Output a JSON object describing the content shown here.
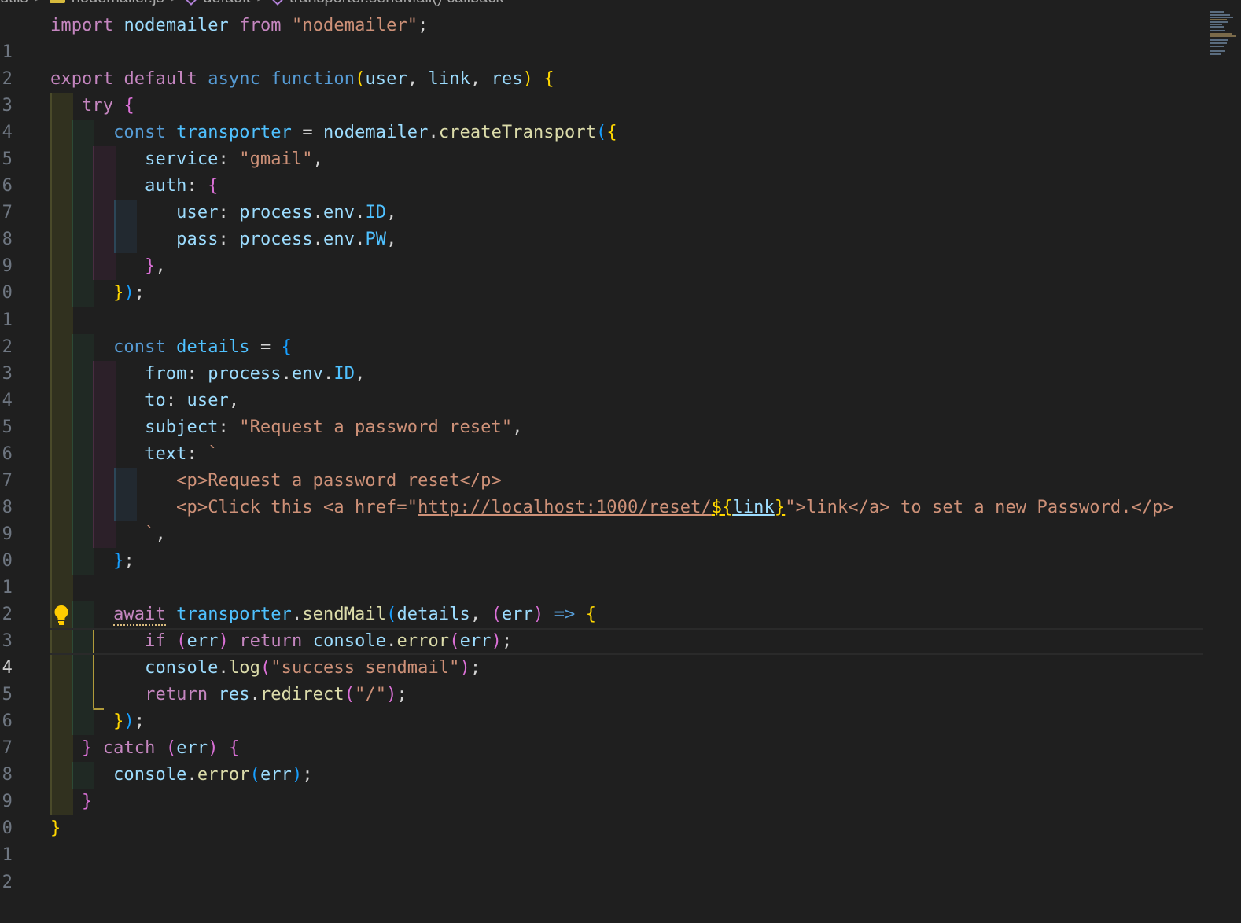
{
  "breadcrumb": {
    "items": [
      "utils",
      "nodemailer.js",
      "default",
      "transporter.sendMail() callback"
    ],
    "separator": ">",
    "js_badge": "JS"
  },
  "editor": {
    "active_line": 24,
    "lines": [
      {
        "n": "1"
      },
      {
        "n": "2"
      },
      {
        "n": "3"
      },
      {
        "n": "4"
      },
      {
        "n": "5"
      },
      {
        "n": "6"
      },
      {
        "n": "7"
      },
      {
        "n": "8"
      },
      {
        "n": "9"
      },
      {
        "n": "0"
      },
      {
        "n": "1"
      },
      {
        "n": "2"
      },
      {
        "n": "3"
      },
      {
        "n": "4"
      },
      {
        "n": "5"
      },
      {
        "n": "6"
      },
      {
        "n": "7"
      },
      {
        "n": "8"
      },
      {
        "n": "9"
      },
      {
        "n": "0"
      },
      {
        "n": "1"
      },
      {
        "n": "2"
      },
      {
        "n": "3"
      },
      {
        "n": "4"
      },
      {
        "n": "5"
      },
      {
        "n": "6"
      },
      {
        "n": "7"
      },
      {
        "n": "8"
      },
      {
        "n": "9"
      },
      {
        "n": "0"
      },
      {
        "n": "1"
      },
      {
        "n": "2"
      }
    ]
  },
  "colors": {
    "background": "#1f1f1f",
    "keyword": "#c586c0",
    "storage": "#569cd6",
    "function": "#dcdcaa",
    "variable": "#9cdcfe",
    "string": "#ce9178",
    "bracket_gold": "#ffd700",
    "bracket_pink": "#da70d6",
    "bracket_blue": "#179fff"
  },
  "icons": [
    "lightbulb-icon",
    "symbol-method-icon",
    "js-file-icon"
  ]
}
